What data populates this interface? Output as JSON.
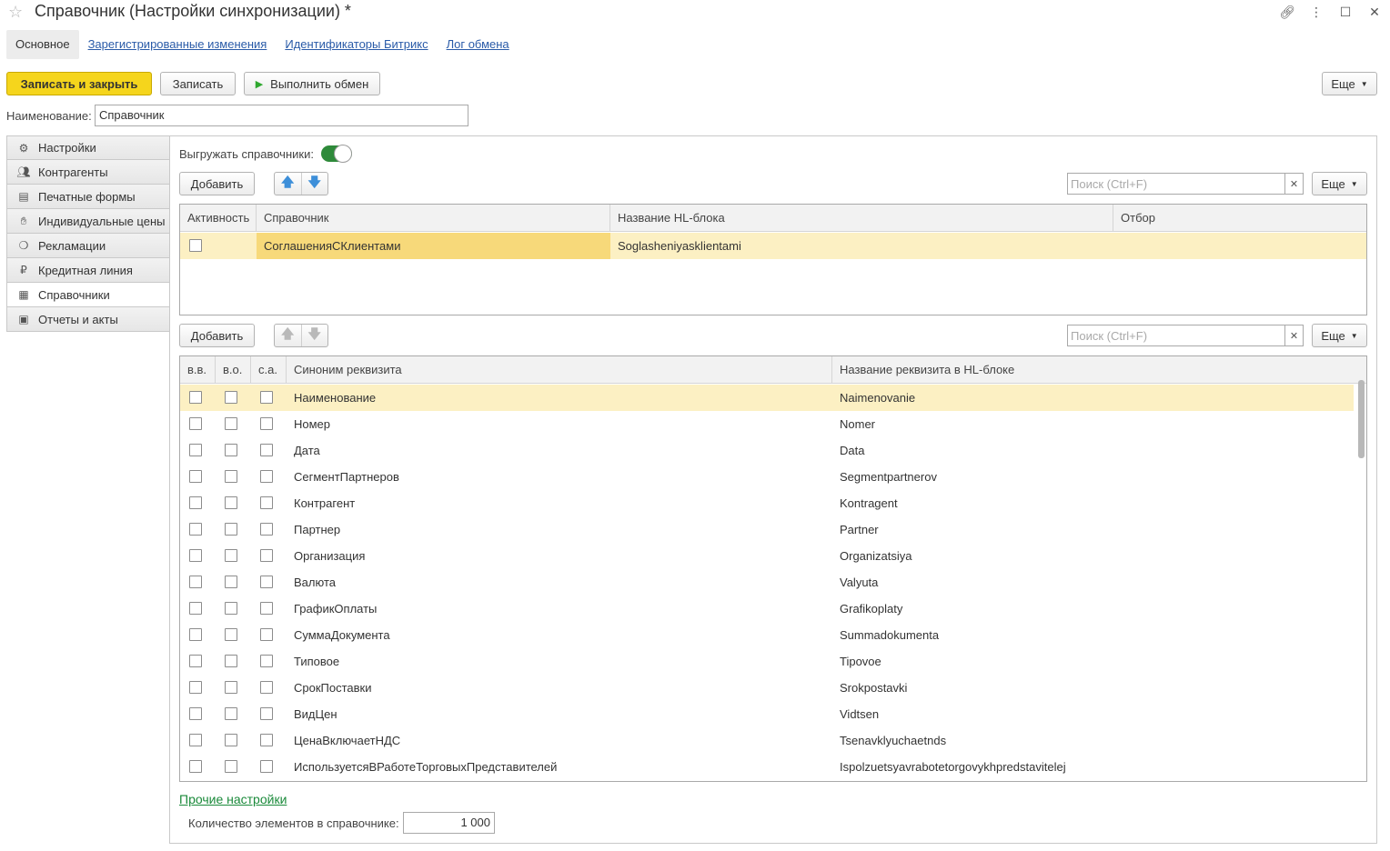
{
  "window": {
    "title": "Справочник (Настройки синхронизации) *"
  },
  "nav_tabs": [
    {
      "label": "Основное"
    },
    {
      "label": "Зарегистрированные изменения"
    },
    {
      "label": "Идентификаторы Битрикс"
    },
    {
      "label": "Лог обмена"
    }
  ],
  "toolbar": {
    "save_close": "Записать и закрыть",
    "save": "Записать",
    "run_exchange": "Выполнить обмен",
    "more": "Еще"
  },
  "name_field": {
    "label": "Наименование:",
    "value": "Справочник"
  },
  "side_tabs": [
    {
      "label": "Настройки",
      "icon": "gear-icon"
    },
    {
      "label": "Контрагенты",
      "icon": "users-icon"
    },
    {
      "label": "Печатные формы",
      "icon": "document-icon"
    },
    {
      "label": "Индивидуальные цены",
      "icon": "handshake-icon"
    },
    {
      "label": "Рекламации",
      "icon": "money-bag-icon"
    },
    {
      "label": "Кредитная линия",
      "icon": "ruble-icon"
    },
    {
      "label": "Справочники",
      "icon": "table-icon"
    },
    {
      "label": "Отчеты и акты",
      "icon": "report-icon"
    }
  ],
  "export_toggle": {
    "label": "Выгружать справочники:",
    "on": true
  },
  "catalogs_toolbar": {
    "add": "Добавить",
    "search_placeholder": "Поиск (Ctrl+F)",
    "more": "Еще"
  },
  "catalogs_table": {
    "columns": [
      "Активность",
      "Справочник",
      "Название HL-блока",
      "Отбор"
    ],
    "rows": [
      {
        "active": false,
        "catalog": "СоглашенияСКлиентами",
        "hl_block": "Soglasheniyasklientami",
        "filter": ""
      }
    ]
  },
  "attrs_toolbar": {
    "add": "Добавить",
    "search_placeholder": "Поиск (Ctrl+F)",
    "more": "Еще"
  },
  "attrs_table": {
    "columns": [
      "в.в.",
      "в.о.",
      "с.а.",
      "Синоним реквизита",
      "Название реквизита в HL-блоке"
    ],
    "rows": [
      {
        "synonym": "Наименование",
        "hl_name": "Naimenovanie"
      },
      {
        "synonym": "Номер",
        "hl_name": "Nomer"
      },
      {
        "synonym": "Дата",
        "hl_name": "Data"
      },
      {
        "synonym": "СегментПартнеров",
        "hl_name": "Segmentpartnerov"
      },
      {
        "synonym": "Контрагент",
        "hl_name": "Kontragent"
      },
      {
        "synonym": "Партнер",
        "hl_name": "Partner"
      },
      {
        "synonym": "Организация",
        "hl_name": "Organizatsiya"
      },
      {
        "synonym": "Валюта",
        "hl_name": "Valyuta"
      },
      {
        "synonym": "ГрафикОплаты",
        "hl_name": "Grafikoplaty"
      },
      {
        "synonym": "СуммаДокумента",
        "hl_name": "Summadokumenta"
      },
      {
        "synonym": "Типовое",
        "hl_name": "Tipovoe"
      },
      {
        "synonym": "СрокПоставки",
        "hl_name": "Srokpostavki"
      },
      {
        "synonym": "ВидЦен",
        "hl_name": "Vidtsen"
      },
      {
        "synonym": "ЦенаВключаетНДС",
        "hl_name": "Tsenavklyuchaetnds"
      },
      {
        "synonym": "ИспользуетсяВРаботеТорговыхПредставителей",
        "hl_name": "Ispolzuetsyavrabotetorgovykhpredstavitelej"
      }
    ]
  },
  "other_settings": {
    "link": "Прочие настройки",
    "count_label": "Количество элементов в справочнике:",
    "count_value": "1 000"
  }
}
